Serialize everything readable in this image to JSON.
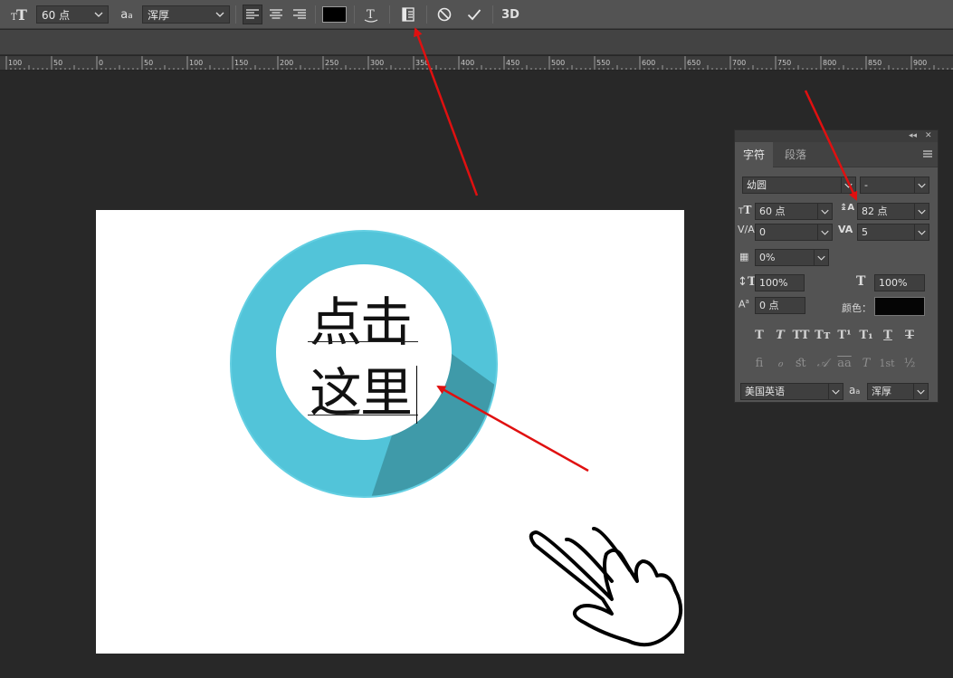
{
  "options_bar": {
    "font_size": "60 点",
    "aa_label": "a",
    "aa_sub": "a",
    "antialias": "浑厚",
    "threeD_label": "3D"
  },
  "ruler": {
    "labels": [
      "100",
      "50",
      "0",
      "50",
      "100",
      "150",
      "200",
      "250",
      "300",
      "350",
      "400",
      "450",
      "500",
      "550",
      "600",
      "650",
      "700",
      "750",
      "800",
      "850",
      "900"
    ]
  },
  "canvas": {
    "line1": "点击",
    "line2": "这里"
  },
  "panel": {
    "tabs": [
      "字符",
      "段落"
    ],
    "font_family": "幼圆",
    "font_style": "-",
    "font_size": "60 点",
    "leading": "82 点",
    "kerning": "0",
    "tracking": "5",
    "tsume": "0%",
    "vertical_scale": "100%",
    "horizontal_scale": "100%",
    "baseline_shift": "0 点",
    "color_label": "颜色：",
    "language": "美国英语",
    "aa_label": "a",
    "antialias": "浑厚",
    "style_buttons": [
      "T",
      "T",
      "TT",
      "Tт",
      "T¹",
      "T₁",
      "T",
      "T"
    ],
    "opentype_buttons": [
      "ﬁ",
      "ℴ",
      "ﬆ",
      "𝒜",
      "aa",
      "T",
      "1st",
      "½"
    ],
    "colors": {
      "text_color": "#050505"
    }
  },
  "colors": {
    "ring": "#52c4d9",
    "shadow": "#3f9aa9",
    "arrow": "#e01010"
  }
}
